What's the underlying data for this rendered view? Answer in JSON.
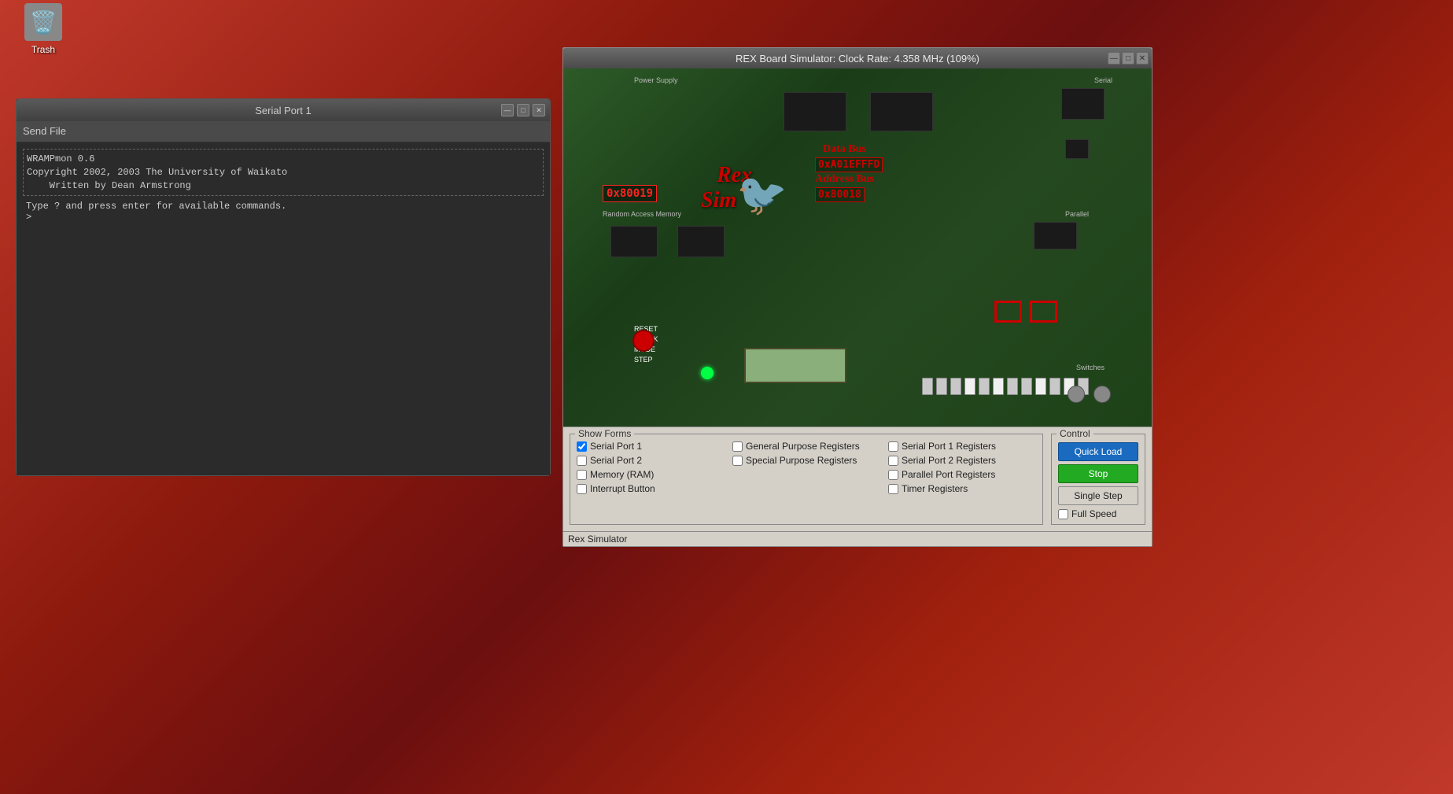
{
  "desktop": {
    "trash_label": "Trash"
  },
  "serial_window": {
    "title": "Serial Port 1",
    "send_file_label": "Send File",
    "terminal_text": "WRAMPmon 0.6\nCopyright 2002, 2003 The University of Waikato\n    Written by Dean Armstrong",
    "prompt_text": "Type ? and press enter for available commands.\n>",
    "win_btns": [
      "—",
      "□",
      "✕"
    ]
  },
  "rex_window": {
    "title": "REX Board Simulator: Clock Rate: 4.358 MHz (109%)",
    "data_bus_label": "Data Bus",
    "data_bus_value": "0xA01EFFFD",
    "addr_bus_label": "Address Bus",
    "addr_bus_value": "0x80018",
    "pc_value": "0x80019",
    "win_btns": [
      "—",
      "□",
      "✕"
    ],
    "board_labels": {
      "power_supply": "Power Supply",
      "serial": "Serial",
      "random_access_memory": "Random Access Memory",
      "parallel": "Parallel",
      "switches": "Switches"
    }
  },
  "show_forms": {
    "legend": "Show Forms",
    "checkboxes": [
      {
        "label": "Serial Port 1",
        "checked": true
      },
      {
        "label": "General Purpose Registers",
        "checked": false
      },
      {
        "label": "Serial Port 1 Registers",
        "checked": false
      },
      {
        "label": "Serial Port 2",
        "checked": false
      },
      {
        "label": "Special Purpose Registers",
        "checked": false
      },
      {
        "label": "Serial Port 2 Registers",
        "checked": false
      },
      {
        "label": "Memory (RAM)",
        "checked": false
      },
      {
        "label": "",
        "checked": false
      },
      {
        "label": "Parallel Port Registers",
        "checked": false
      },
      {
        "label": "Interrupt Button",
        "checked": false
      },
      {
        "label": "",
        "checked": false
      },
      {
        "label": "Timer Registers",
        "checked": false
      }
    ]
  },
  "control": {
    "legend": "Control",
    "quick_load_label": "Quick Load",
    "stop_label": "Stop",
    "single_step_label": "Single Step",
    "full_speed_label": "Full Speed",
    "full_speed_checked": false
  },
  "statusbar": {
    "text": "Rex Simulator"
  }
}
